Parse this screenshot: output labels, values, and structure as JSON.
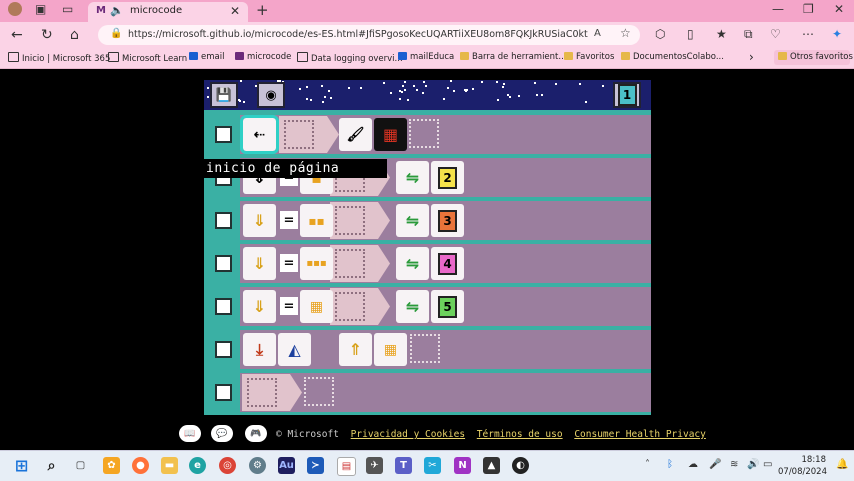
{
  "browser": {
    "tab_title": "microcode",
    "tab_favicon": "M",
    "url": "https://microsoft.github.io/microcode/es-ES.html#JfiSPgosoKecUQARTiiXEU8om8FQKJkRUSiaC0ktngEKLKCO...",
    "bookmarks": [
      {
        "label": "Inicio | Microsoft 365",
        "icon": "page-icon",
        "color": "#333"
      },
      {
        "label": "Microsoft Learn",
        "icon": "page-icon",
        "color": "#333"
      },
      {
        "label": "email",
        "icon": "mail-icon",
        "color": "#1a5fd1"
      },
      {
        "label": "microcode",
        "icon": "microcode-icon",
        "color": "#6b2a7a"
      },
      {
        "label": "Data logging overvi...",
        "icon": "page-icon",
        "color": "#333"
      },
      {
        "label": "mailEduca",
        "icon": "mail-icon",
        "color": "#1a5fd1"
      },
      {
        "label": "Barra de herramient...",
        "icon": "folder-icon",
        "color": "#e6b84a"
      },
      {
        "label": "Favoritos",
        "icon": "folder-icon",
        "color": "#e6b84a"
      },
      {
        "label": "DocumentosColabo...",
        "icon": "folder-icon",
        "color": "#e6b84a"
      }
    ],
    "other_favorites": "Otros favoritos"
  },
  "editor": {
    "page_number": "1",
    "tooltip": "inicio de página",
    "rows": [
      {
        "when": "page-start",
        "do": [
          "screen",
          "pattern"
        ],
        "numbers": []
      },
      {
        "when": "button-press",
        "op": "=",
        "value": "1",
        "do": [
          "switch-page"
        ],
        "page": "2",
        "page_color": "#f5e24a"
      },
      {
        "when": "button-press",
        "op": "=",
        "value": "2",
        "do": [
          "switch-page"
        ],
        "page": "3",
        "page_color": "#e9743a"
      },
      {
        "when": "button-press",
        "op": "=",
        "value": "3",
        "do": [
          "switch-page"
        ],
        "page": "4",
        "page_color": "#e968c9"
      },
      {
        "when": "button-press",
        "op": "=",
        "value": "4",
        "do": [
          "switch-page"
        ],
        "page": "5",
        "page_color": "#6bd15c"
      },
      {
        "when": "receive",
        "filter": "A",
        "do": [
          "radio-send",
          "value-4"
        ]
      },
      {
        "when": "empty",
        "do": []
      }
    ]
  },
  "footer": {
    "copyright": "© Microsoft",
    "links": [
      "Privacidad y Cookies",
      "Términos de uso",
      "Consumer Health Privacy"
    ]
  },
  "taskbar": {
    "time": "18:18",
    "date": "07/08/2024"
  }
}
